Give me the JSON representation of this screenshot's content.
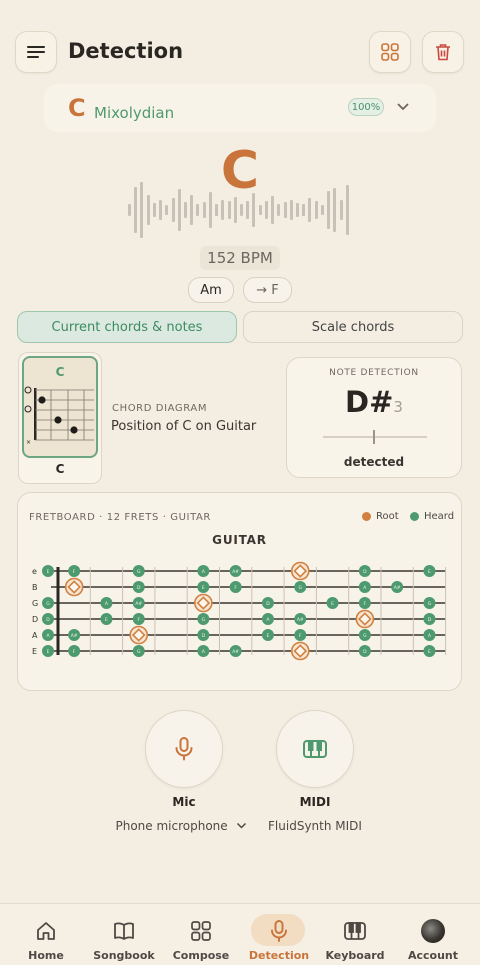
{
  "header": {
    "title": "Detection"
  },
  "key": {
    "root": "C",
    "mode": "Mixolydian",
    "confidence": "100%"
  },
  "detected_chord": "C",
  "bpm": "152 BPM",
  "chips": {
    "from": "Am",
    "to": "→ F"
  },
  "tabs": {
    "active": "Current chords & notes",
    "inactive": "Scale chords"
  },
  "chord_diagram": {
    "name": "C",
    "caption": "C",
    "section_label": "CHORD DIAGRAM",
    "description": "Position of C on Guitar"
  },
  "note_detection": {
    "label": "NOTE DETECTION",
    "note": "D#",
    "octave": "3",
    "status": "detected"
  },
  "fretboard": {
    "header": "FRETBOARD · 12 FRETS · GUITAR",
    "title": "GUITAR",
    "legend": {
      "root": "Root",
      "heard": "Heard"
    },
    "strings": [
      "e",
      "B",
      "G",
      "D",
      "A",
      "E"
    ],
    "colors": {
      "root": "#d0813f",
      "heard": "#4e9a6f"
    },
    "notes": [
      {
        "s": 0,
        "f": 0,
        "n": "E"
      },
      {
        "s": 0,
        "f": 1,
        "n": "F"
      },
      {
        "s": 0,
        "f": 3,
        "n": "G"
      },
      {
        "s": 0,
        "f": 5,
        "n": "A"
      },
      {
        "s": 0,
        "f": 6,
        "n": "A#"
      },
      {
        "s": 0,
        "f": 8,
        "n": "C",
        "r": true
      },
      {
        "s": 0,
        "f": 10,
        "n": "D"
      },
      {
        "s": 0,
        "f": 12,
        "n": "E"
      },
      {
        "s": 1,
        "f": 1,
        "n": "C",
        "r": true
      },
      {
        "s": 1,
        "f": 3,
        "n": "D"
      },
      {
        "s": 1,
        "f": 5,
        "n": "E"
      },
      {
        "s": 1,
        "f": 6,
        "n": "F"
      },
      {
        "s": 1,
        "f": 8,
        "n": "G"
      },
      {
        "s": 1,
        "f": 10,
        "n": "A"
      },
      {
        "s": 1,
        "f": 11,
        "n": "A#"
      },
      {
        "s": 2,
        "f": 0,
        "n": "G"
      },
      {
        "s": 2,
        "f": 2,
        "n": "A"
      },
      {
        "s": 2,
        "f": 3,
        "n": "A#"
      },
      {
        "s": 2,
        "f": 5,
        "n": "C",
        "r": true
      },
      {
        "s": 2,
        "f": 7,
        "n": "D"
      },
      {
        "s": 2,
        "f": 9,
        "n": "E"
      },
      {
        "s": 2,
        "f": 10,
        "n": "F"
      },
      {
        "s": 2,
        "f": 12,
        "n": "G"
      },
      {
        "s": 3,
        "f": 0,
        "n": "D"
      },
      {
        "s": 3,
        "f": 2,
        "n": "E"
      },
      {
        "s": 3,
        "f": 3,
        "n": "F"
      },
      {
        "s": 3,
        "f": 5,
        "n": "G"
      },
      {
        "s": 3,
        "f": 7,
        "n": "A"
      },
      {
        "s": 3,
        "f": 8,
        "n": "A#"
      },
      {
        "s": 3,
        "f": 10,
        "n": "C",
        "r": true
      },
      {
        "s": 3,
        "f": 12,
        "n": "D"
      },
      {
        "s": 4,
        "f": 0,
        "n": "A"
      },
      {
        "s": 4,
        "f": 1,
        "n": "A#"
      },
      {
        "s": 4,
        "f": 3,
        "n": "C",
        "r": true
      },
      {
        "s": 4,
        "f": 5,
        "n": "D"
      },
      {
        "s": 4,
        "f": 7,
        "n": "E"
      },
      {
        "s": 4,
        "f": 8,
        "n": "F"
      },
      {
        "s": 4,
        "f": 10,
        "n": "G"
      },
      {
        "s": 4,
        "f": 12,
        "n": "A"
      },
      {
        "s": 5,
        "f": 0,
        "n": "E"
      },
      {
        "s": 5,
        "f": 1,
        "n": "F"
      },
      {
        "s": 5,
        "f": 3,
        "n": "G"
      },
      {
        "s": 5,
        "f": 5,
        "n": "A"
      },
      {
        "s": 5,
        "f": 6,
        "n": "A#"
      },
      {
        "s": 5,
        "f": 8,
        "n": "C",
        "r": true
      },
      {
        "s": 5,
        "f": 10,
        "n": "D"
      },
      {
        "s": 5,
        "f": 12,
        "n": "E"
      }
    ]
  },
  "inputs": {
    "mic_label": "Mic",
    "mic_source": "Phone microphone",
    "midi_label": "MIDI",
    "midi_source": "FluidSynth MIDI"
  },
  "nav": {
    "home": "Home",
    "songbook": "Songbook",
    "compose": "Compose",
    "detection": "Detection",
    "keyboard": "Keyboard",
    "account": "Account"
  },
  "colors": {
    "accent": "#c8743a",
    "green": "#4e9a6f",
    "background": "#f4eee2"
  }
}
